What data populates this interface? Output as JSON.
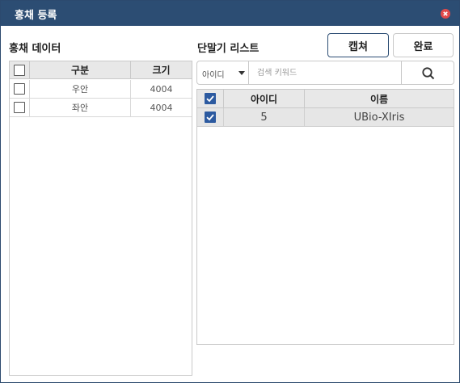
{
  "dialog": {
    "title": "홍채 등록",
    "close_icon": "close-icon"
  },
  "left_panel": {
    "title": "홍채 데이터",
    "columns": [
      "구분",
      "크기"
    ],
    "rows": [
      {
        "type": "우안",
        "size": "4004",
        "checked": false
      },
      {
        "type": "좌안",
        "size": "4004",
        "checked": false
      }
    ],
    "header_checked": false
  },
  "right_panel": {
    "title": "단말기 리스트",
    "search": {
      "field_selected": "아이디",
      "placeholder": "검색 키워드",
      "value": "",
      "search_icon": "search-icon"
    },
    "columns": [
      "아이디",
      "이름"
    ],
    "rows": [
      {
        "id": "5",
        "name": "UBio-XIris",
        "checked": true
      }
    ],
    "header_checked": true
  },
  "buttons": {
    "capture_label": "캡쳐",
    "done_label": "완료"
  },
  "colors": {
    "titlebar": "#2c4d73",
    "checkbox_checked": "#2c5aa0",
    "close": "#e24a4a"
  }
}
